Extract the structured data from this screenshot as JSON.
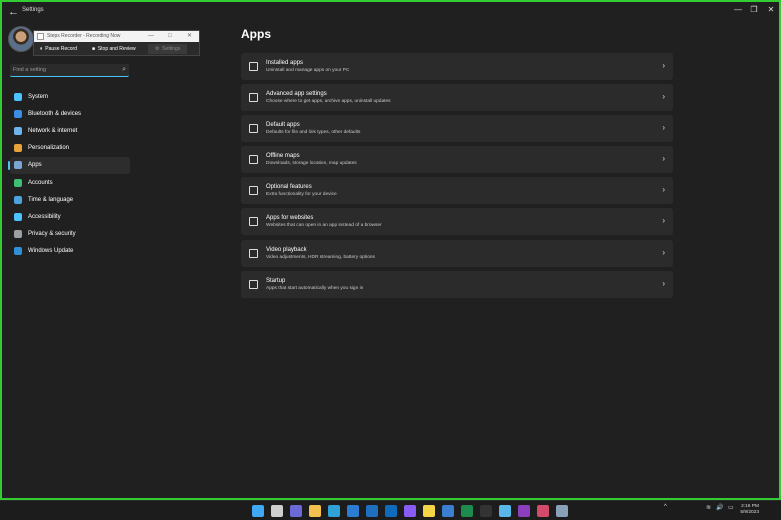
{
  "window": {
    "title": "Settings",
    "back_glyph": "←",
    "controls": [
      "—",
      "❐",
      "✕"
    ]
  },
  "recorder": {
    "title": "Steps Recorder - Recording Now",
    "controls": [
      "—",
      "□",
      "✕"
    ],
    "pause": "Pause Record",
    "stop": "Stop and Review",
    "settings": "Settings"
  },
  "search": {
    "placeholder": "Find a setting",
    "icon": "⌕"
  },
  "sidebar": {
    "items": [
      {
        "label": "System",
        "icon": "system-icon",
        "color": "#4cc2ff"
      },
      {
        "label": "Bluetooth & devices",
        "icon": "bluetooth-icon",
        "color": "#3a8ee6"
      },
      {
        "label": "Network & internet",
        "icon": "wifi-icon",
        "color": "#6cb4ee"
      },
      {
        "label": "Personalization",
        "icon": "brush-icon",
        "color": "#e8a23a"
      },
      {
        "label": "Apps",
        "icon": "apps-icon",
        "color": "#7aa6d6"
      },
      {
        "label": "Accounts",
        "icon": "person-icon",
        "color": "#3fbf74"
      },
      {
        "label": "Time & language",
        "icon": "globe-clock-icon",
        "color": "#4ca3e0"
      },
      {
        "label": "Accessibility",
        "icon": "accessibility-icon",
        "color": "#4cc2ff"
      },
      {
        "label": "Privacy & security",
        "icon": "shield-icon",
        "color": "#9aa0a6"
      },
      {
        "label": "Windows Update",
        "icon": "update-icon",
        "color": "#2f8fd8"
      }
    ],
    "active_index": 4
  },
  "main": {
    "title": "Apps",
    "cards": [
      {
        "title": "Installed apps",
        "subtitle": "Uninstall and manage apps on your PC",
        "icon": "list-icon"
      },
      {
        "title": "Advanced app settings",
        "subtitle": "Choose where to get apps, archive apps, uninstall updates",
        "icon": "advanced-apps-icon"
      },
      {
        "title": "Default apps",
        "subtitle": "Defaults for file and link types, other defaults",
        "icon": "default-apps-icon"
      },
      {
        "title": "Offline maps",
        "subtitle": "Downloads, storage location, map updates",
        "icon": "map-icon"
      },
      {
        "title": "Optional features",
        "subtitle": "Extra functionality for your device",
        "icon": "optional-features-icon"
      },
      {
        "title": "Apps for websites",
        "subtitle": "Websites that can open in an app instead of a browser",
        "icon": "web-apps-icon"
      },
      {
        "title": "Video playback",
        "subtitle": "Video adjustments, HDR streaming, battery options",
        "icon": "video-icon"
      },
      {
        "title": "Startup",
        "subtitle": "Apps that start automatically when you sign in",
        "icon": "startup-icon"
      }
    ],
    "chevron": "›"
  },
  "taskbar": {
    "apps": [
      {
        "name": "start-icon",
        "color": "#3fa9f5"
      },
      {
        "name": "search-icon",
        "color": "#cfcfcf"
      },
      {
        "name": "teams-icon",
        "color": "#6b69d6"
      },
      {
        "name": "file-explorer-icon",
        "color": "#f2c14e"
      },
      {
        "name": "edge-icon",
        "color": "#2fa3d8"
      },
      {
        "name": "chat-icon",
        "color": "#2b7cd3"
      },
      {
        "name": "mail-icon",
        "color": "#1f6fbf"
      },
      {
        "name": "outlook-icon",
        "color": "#0f6cbd"
      },
      {
        "name": "clipchamp-icon",
        "color": "#8a5cf6"
      },
      {
        "name": "sticky-notes-icon",
        "color": "#f5d547"
      },
      {
        "name": "visual-studio-icon",
        "color": "#3a7fd0"
      },
      {
        "name": "excel-icon",
        "color": "#1d8a4e"
      },
      {
        "name": "terminal-icon",
        "color": "#333333"
      },
      {
        "name": "notepad-icon",
        "color": "#5ab8e8"
      },
      {
        "name": "onenote-icon",
        "color": "#8b3fbf"
      },
      {
        "name": "snipping-tool-icon",
        "color": "#d24b6a"
      },
      {
        "name": "settings-icon",
        "color": "#8aa0b8"
      }
    ],
    "tray": {
      "chevron": "^",
      "wifi": "≋",
      "volume": "🔊",
      "battery": "▭"
    },
    "time": "2:16 PM",
    "date": "5/9/2023"
  }
}
